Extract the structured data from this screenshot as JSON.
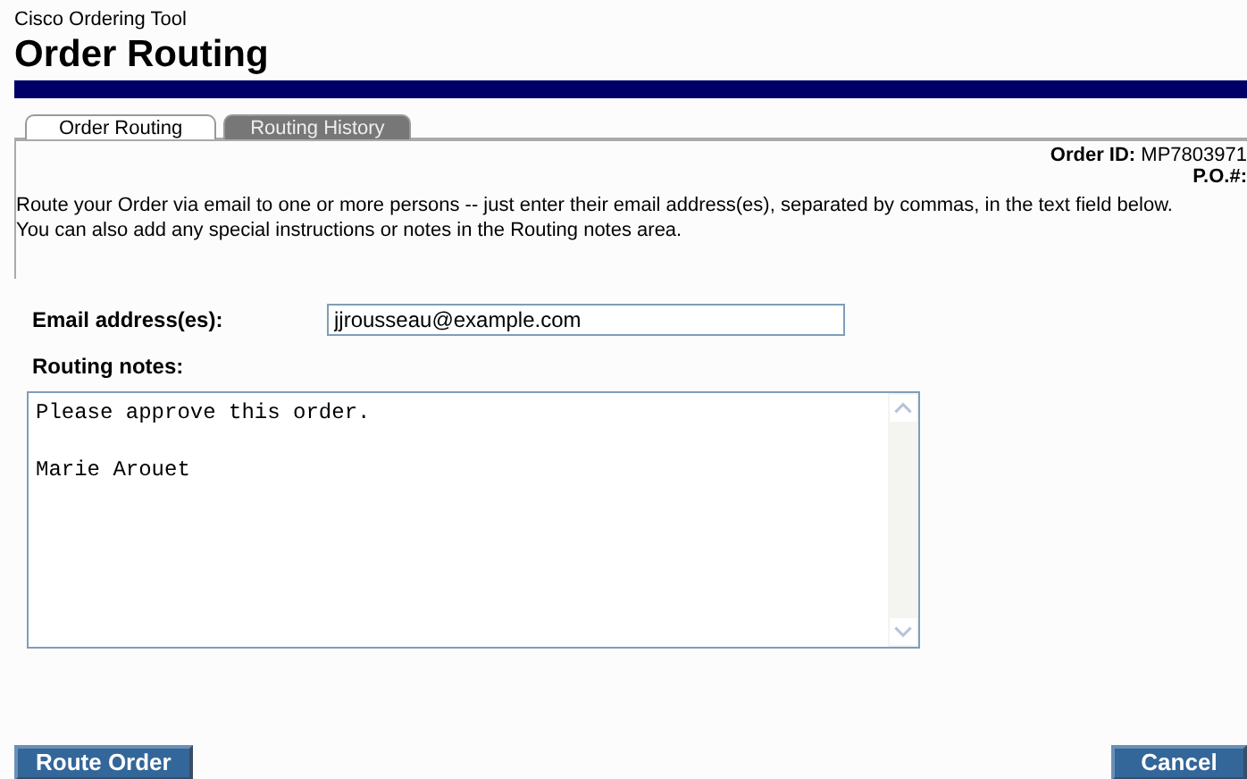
{
  "app_name": "Cisco Ordering Tool",
  "page_title": "Order Routing",
  "tabs": [
    {
      "label": "Order Routing",
      "selected": true
    },
    {
      "label": "Routing History",
      "selected": false
    }
  ],
  "order_id": {
    "label": "Order ID:",
    "value": "MP7803971"
  },
  "po": {
    "label": "P.O.#:"
  },
  "instructions": "Route your Order via email to one or more persons -- just enter their email address(es), separated by commas, in the text field below. You can also add any special instructions or notes in the Routing notes area.",
  "email": {
    "label": "Email address(es):",
    "value": "jjrousseau@example.com"
  },
  "notes": {
    "label": "Routing notes:",
    "value": "Please approve this order.\n\nMarie Arouet"
  },
  "buttons": [
    {
      "label": "Route Order"
    },
    {
      "label": "Cancel"
    }
  ]
}
